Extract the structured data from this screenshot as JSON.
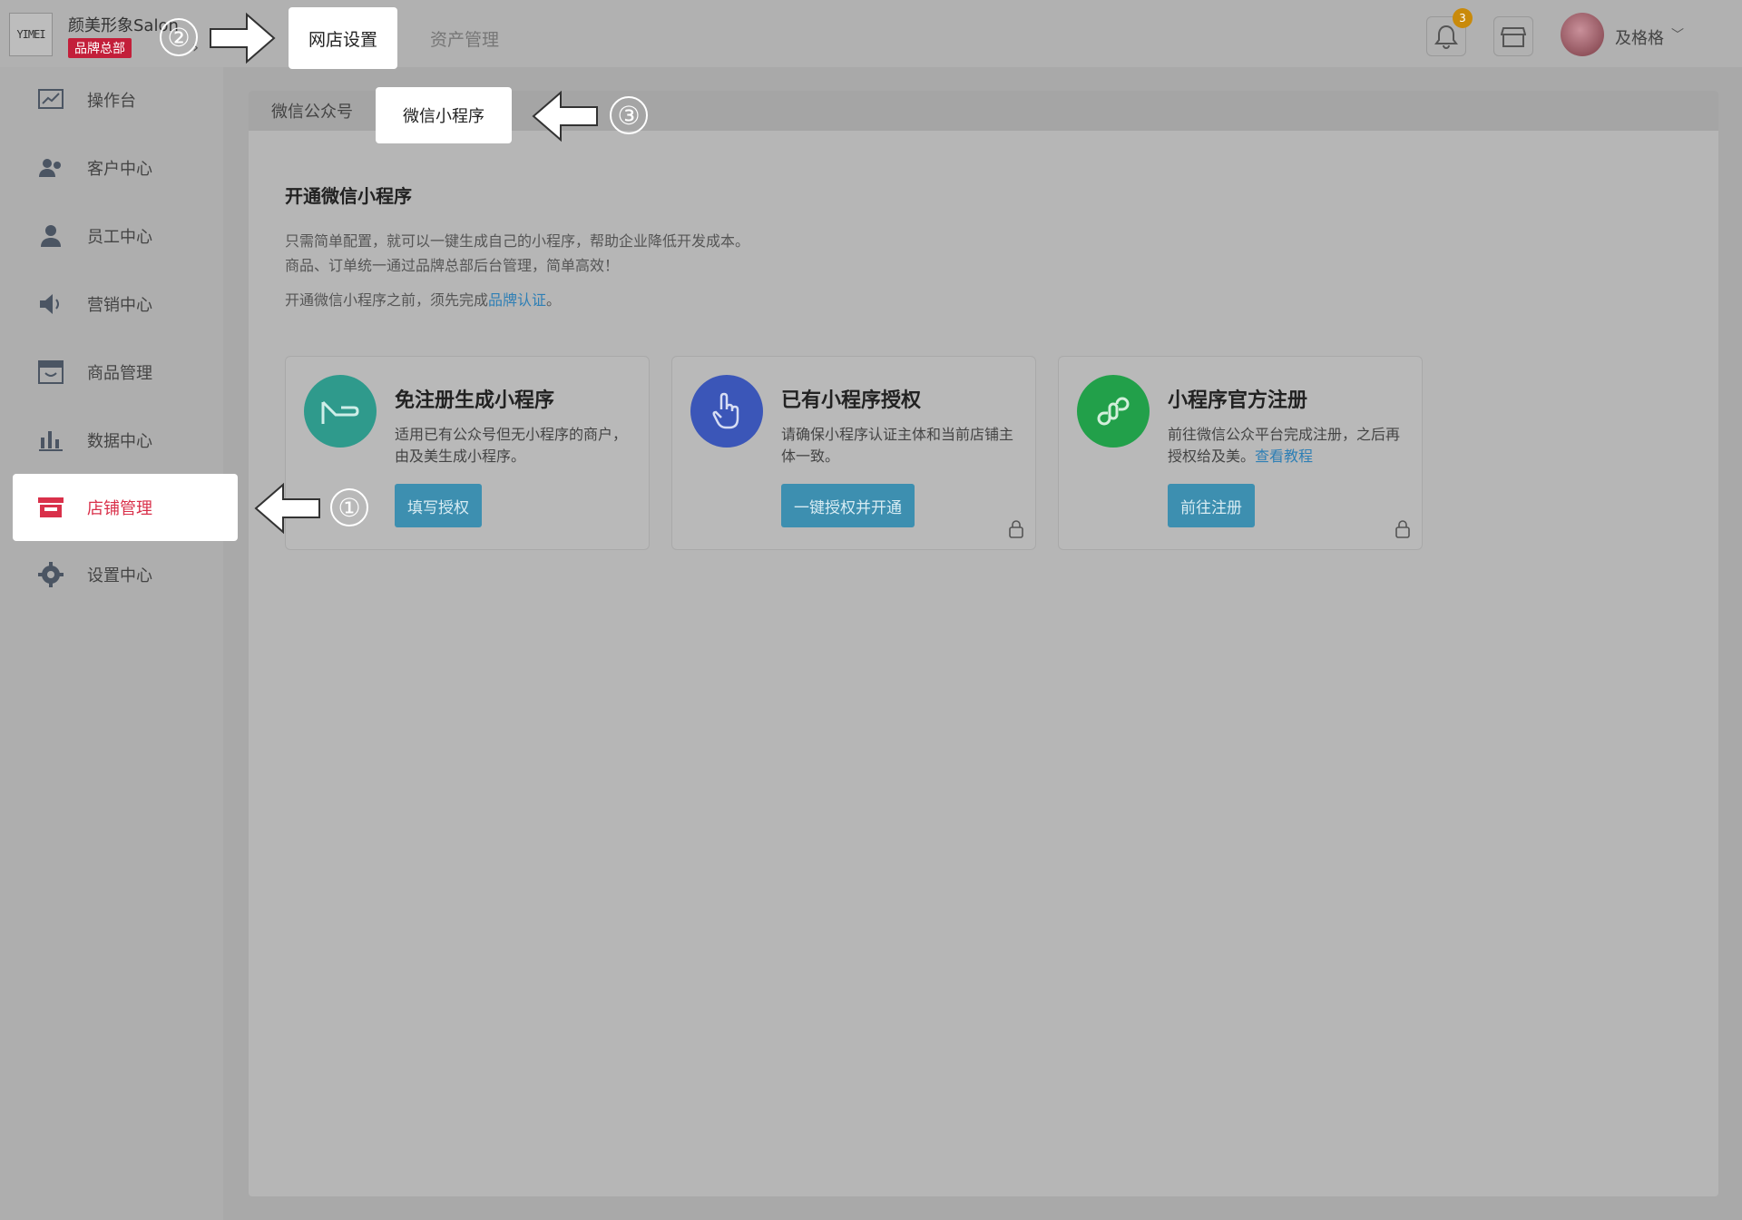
{
  "brand": {
    "logo_text": "YIMEI",
    "name": "颜美形象Salon",
    "badge": "品牌总部"
  },
  "top_tabs": [
    {
      "label": "网店设置",
      "active": true
    },
    {
      "label": "资产管理",
      "active": false
    }
  ],
  "header": {
    "notification_count": "3",
    "username": "及格格"
  },
  "sidebar": {
    "items": [
      {
        "label": "操作台",
        "icon": "chart-line-icon"
      },
      {
        "label": "客户中心",
        "icon": "users-icon"
      },
      {
        "label": "员工中心",
        "icon": "user-icon"
      },
      {
        "label": "营销中心",
        "icon": "speaker-icon"
      },
      {
        "label": "商品管理",
        "icon": "box-icon"
      },
      {
        "label": "数据中心",
        "icon": "bar-chart-icon"
      },
      {
        "label": "店铺管理",
        "icon": "store-icon",
        "active": true
      },
      {
        "label": "设置中心",
        "icon": "gear-icon"
      }
    ]
  },
  "sub_tabs": [
    {
      "label": "微信公众号",
      "active": false
    },
    {
      "label": "微信小程序",
      "active": true
    }
  ],
  "main": {
    "title": "开通微信小程序",
    "desc_line1": "只需简单配置，就可以一键生成自己的小程序，帮助企业降低开发成本。",
    "desc_line2": "商品、订单统一通过品牌总部后台管理，简单高效！",
    "notice_prefix": "开通微信小程序之前，须先完成",
    "notice_link": "品牌认证",
    "notice_suffix": "。"
  },
  "cards": [
    {
      "title": "免注册生成小程序",
      "text": "适用已有公众号但无小程序的商户，由及美生成小程序。",
      "button": "填写授权",
      "color": "#2f9a8c"
    },
    {
      "title": "已有小程序授权",
      "text": "请确保小程序认证主体和当前店铺主体一致。",
      "button": "一键授权并开通",
      "color": "#3b56b8"
    },
    {
      "title": "小程序官方注册",
      "text": "前往微信公众平台完成注册，之后再授权给及美。",
      "link": "查看教程",
      "button": "前往注册",
      "color": "#22a04a"
    }
  ],
  "annotations": {
    "one": "①",
    "two": "②",
    "three": "③"
  }
}
